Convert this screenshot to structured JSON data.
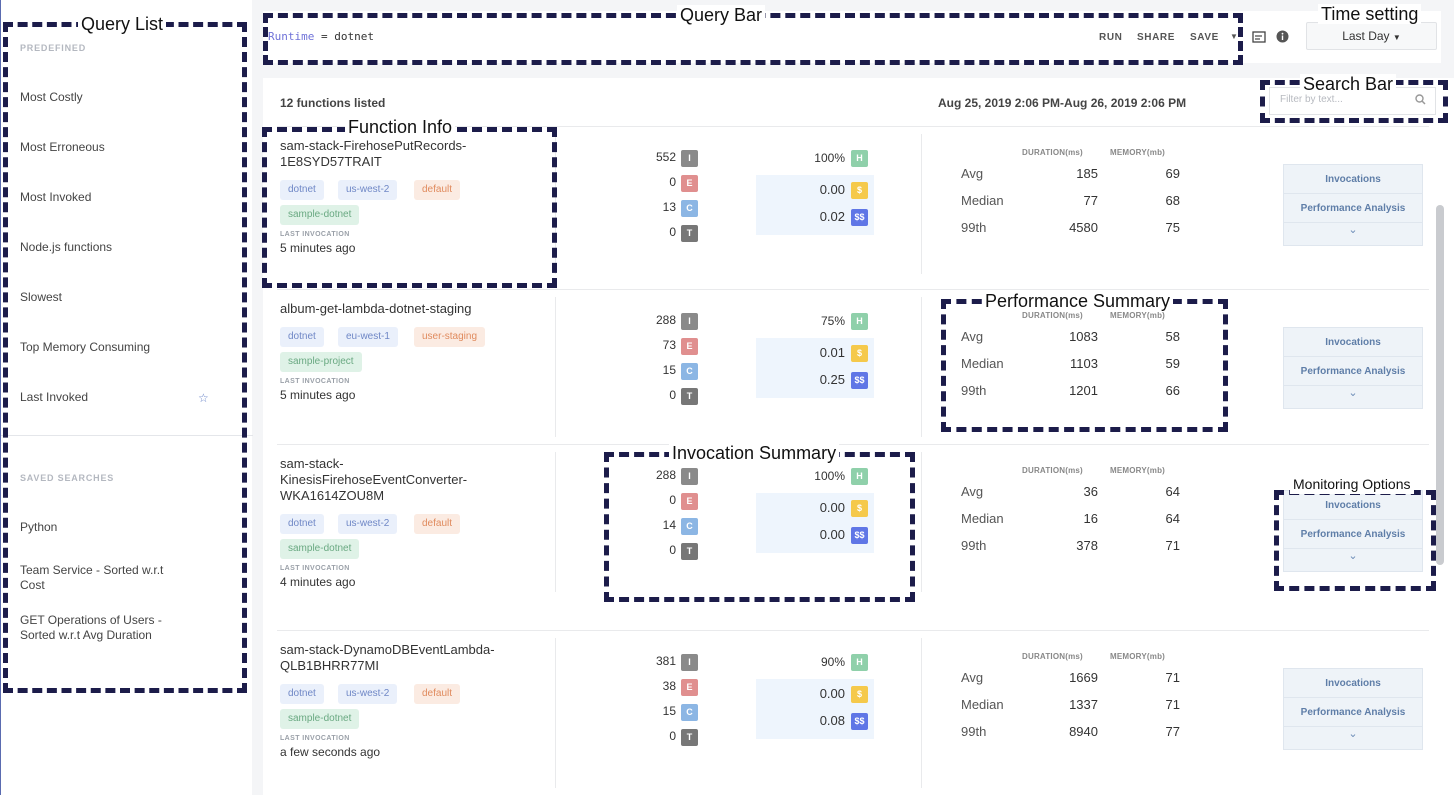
{
  "annotations": {
    "query_list": "Query List",
    "query_bar": "Query Bar",
    "time_setting": "Time setting",
    "search_bar": "Search Bar",
    "function_info": "Function Info",
    "performance_summary": "Performance Summary",
    "invocation_summary": "Invocation Summary",
    "monitoring_options": "Monitoring Options"
  },
  "sidebar": {
    "predefined_title": "PREDEFINED",
    "predefined": [
      "Most Costly",
      "Most Erroneous",
      "Most Invoked",
      "Node.js functions",
      "Slowest",
      "Top Memory Consuming",
      "Last Invoked"
    ],
    "saved_title": "SAVED SEARCHES",
    "saved": [
      "Python",
      "Team Service - Sorted w.r.t Cost",
      "GET Operations of Users - Sorted w.r.t Avg Duration"
    ]
  },
  "querybar": {
    "key": "Runtime",
    "operator": "=",
    "value": "dotnet",
    "run": "RUN",
    "share": "SHARE",
    "save": "SAVE",
    "time_value": "Last Day"
  },
  "list": {
    "count": "12 functions listed",
    "daterange": "Aug 25, 2019 2:06 PM-Aug 26, 2019 2:06 PM",
    "search_placeholder": "Filter by text...",
    "last_label": "LAST INVOCATION",
    "perf_duration_header": "DURATION(ms)",
    "perf_memory_header": "MEMORY(mb)",
    "perf_labels": [
      "Avg",
      "Median",
      "99th"
    ],
    "monitor_invocations": "Invocations",
    "monitor_performance": "Performance Analysis",
    "functions": [
      {
        "name": "sam-stack-FirehosePutRecords-1E8SYD57TRAIT",
        "tags": [
          "dotnet",
          "us-west-2",
          "default",
          "sample-dotnet"
        ],
        "last": "5 minutes ago",
        "invocations": [
          "552",
          "0",
          "13",
          "0"
        ],
        "health": "100%",
        "cost": "0.00",
        "cost_total": "0.02",
        "duration": [
          "185",
          "77",
          "4580"
        ],
        "memory": [
          "69",
          "68",
          "75"
        ]
      },
      {
        "name": "album-get-lambda-dotnet-staging",
        "tags": [
          "dotnet",
          "eu-west-1",
          "user-staging",
          "sample-project"
        ],
        "last": "5 minutes ago",
        "invocations": [
          "288",
          "73",
          "15",
          "0"
        ],
        "health": "75%",
        "cost": "0.01",
        "cost_total": "0.25",
        "duration": [
          "1083",
          "1103",
          "1201"
        ],
        "memory": [
          "58",
          "59",
          "66"
        ]
      },
      {
        "name": "sam-stack-KinesisFirehoseEventConverter-WKA1614ZOU8M",
        "tags": [
          "dotnet",
          "us-west-2",
          "default",
          "sample-dotnet"
        ],
        "last": "4 minutes ago",
        "invocations": [
          "288",
          "0",
          "14",
          "0"
        ],
        "health": "100%",
        "cost": "0.00",
        "cost_total": "0.00",
        "duration": [
          "36",
          "16",
          "378"
        ],
        "memory": [
          "64",
          "64",
          "71"
        ]
      },
      {
        "name": "sam-stack-DynamoDBEventLambda-QLB1BHRR77MI",
        "tags": [
          "dotnet",
          "us-west-2",
          "default",
          "sample-dotnet"
        ],
        "last": "a few seconds ago",
        "invocations": [
          "381",
          "38",
          "15",
          "0"
        ],
        "health": "90%",
        "cost": "0.00",
        "cost_total": "0.08",
        "duration": [
          "1669",
          "1337",
          "8940"
        ],
        "memory": [
          "71",
          "71",
          "77"
        ]
      }
    ]
  }
}
